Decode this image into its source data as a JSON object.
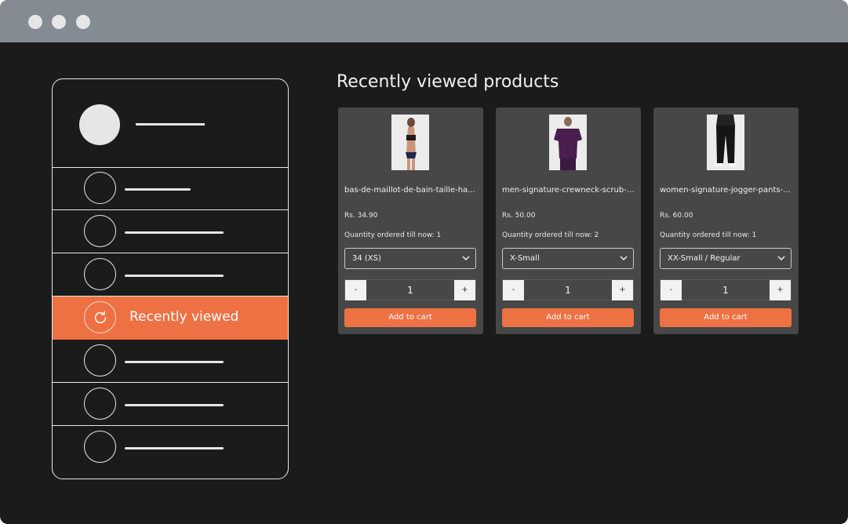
{
  "window": {
    "controls": [
      "close",
      "minimize",
      "maximize"
    ]
  },
  "sidebar": {
    "active_item_label": "Recently viewed",
    "active_item_icon": "refresh-icon"
  },
  "main": {
    "title": "Recently viewed products"
  },
  "products": [
    {
      "name": "bas-de-maillot-de-bain-taille-ha...",
      "price": "Rs. 34.90",
      "quantity_ordered": "Quantity ordered till now: 1",
      "variant": "34 (XS)",
      "quantity": "1",
      "minus": "-",
      "plus": "+",
      "add_to_cart": "Add to cart"
    },
    {
      "name": "men-signature-crewneck-scrub-t...",
      "price": "Rs. 50.00",
      "quantity_ordered": "Quantity ordered till now: 2",
      "variant": "X-Small",
      "quantity": "1",
      "minus": "-",
      "plus": "+",
      "add_to_cart": "Add to cart"
    },
    {
      "name": "women-signature-jogger-pants-...",
      "price": "Rs. 60.00",
      "quantity_ordered": "Quantity ordered till now: 1",
      "variant": "XX-Small / Regular",
      "quantity": "1",
      "minus": "-",
      "plus": "+",
      "add_to_cart": "Add to cart"
    }
  ],
  "colors": {
    "accent": "#ee7143",
    "background": "#1b1b1b",
    "card": "#474747",
    "titlebar": "#858b92"
  }
}
